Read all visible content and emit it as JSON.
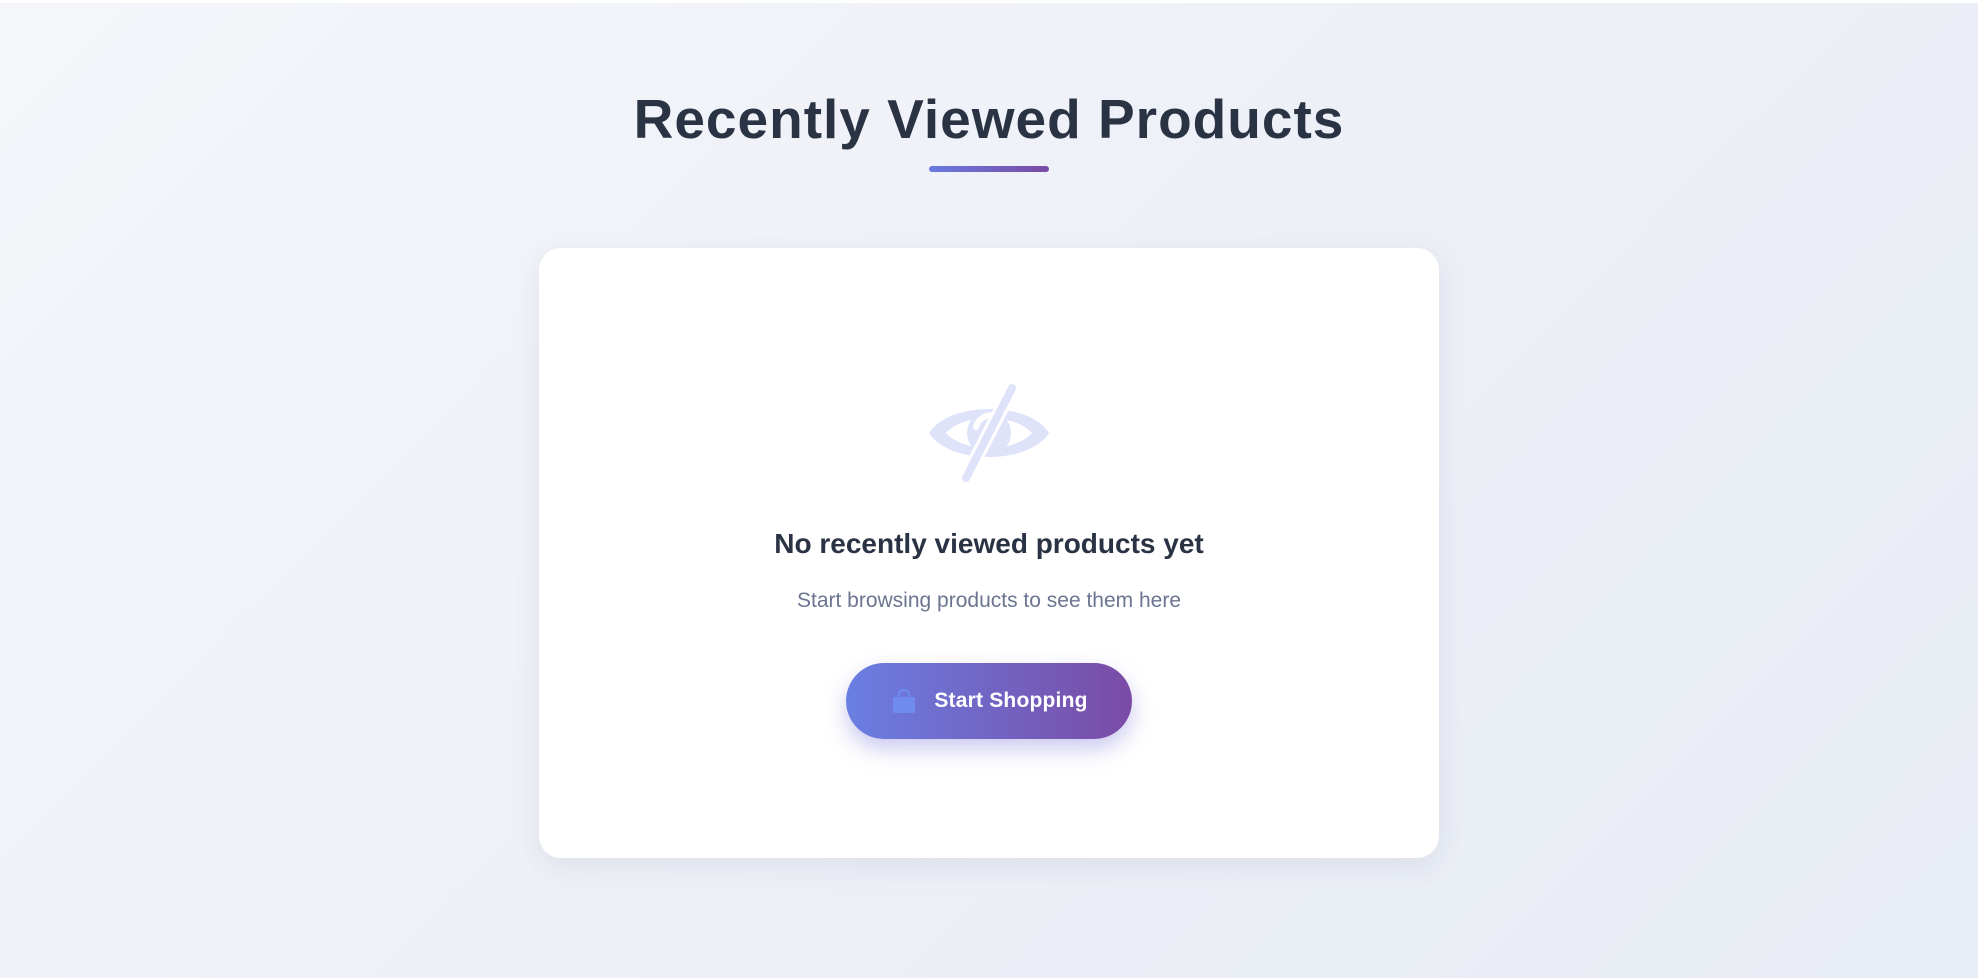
{
  "page": {
    "title": "Recently Viewed Products"
  },
  "empty_state": {
    "icon": "eye-slash-icon",
    "title": "No recently viewed products yet",
    "subtitle": "Start browsing products to see them here"
  },
  "cta": {
    "label": "Start Shopping",
    "icon": "shopping-bag-icon"
  },
  "colors": {
    "heading": "#2a3344",
    "subtext": "#6b7590",
    "accent_start": "#6a7fe2",
    "accent_end": "#7a4ba6",
    "icon_tint": "#dfe3fa"
  }
}
